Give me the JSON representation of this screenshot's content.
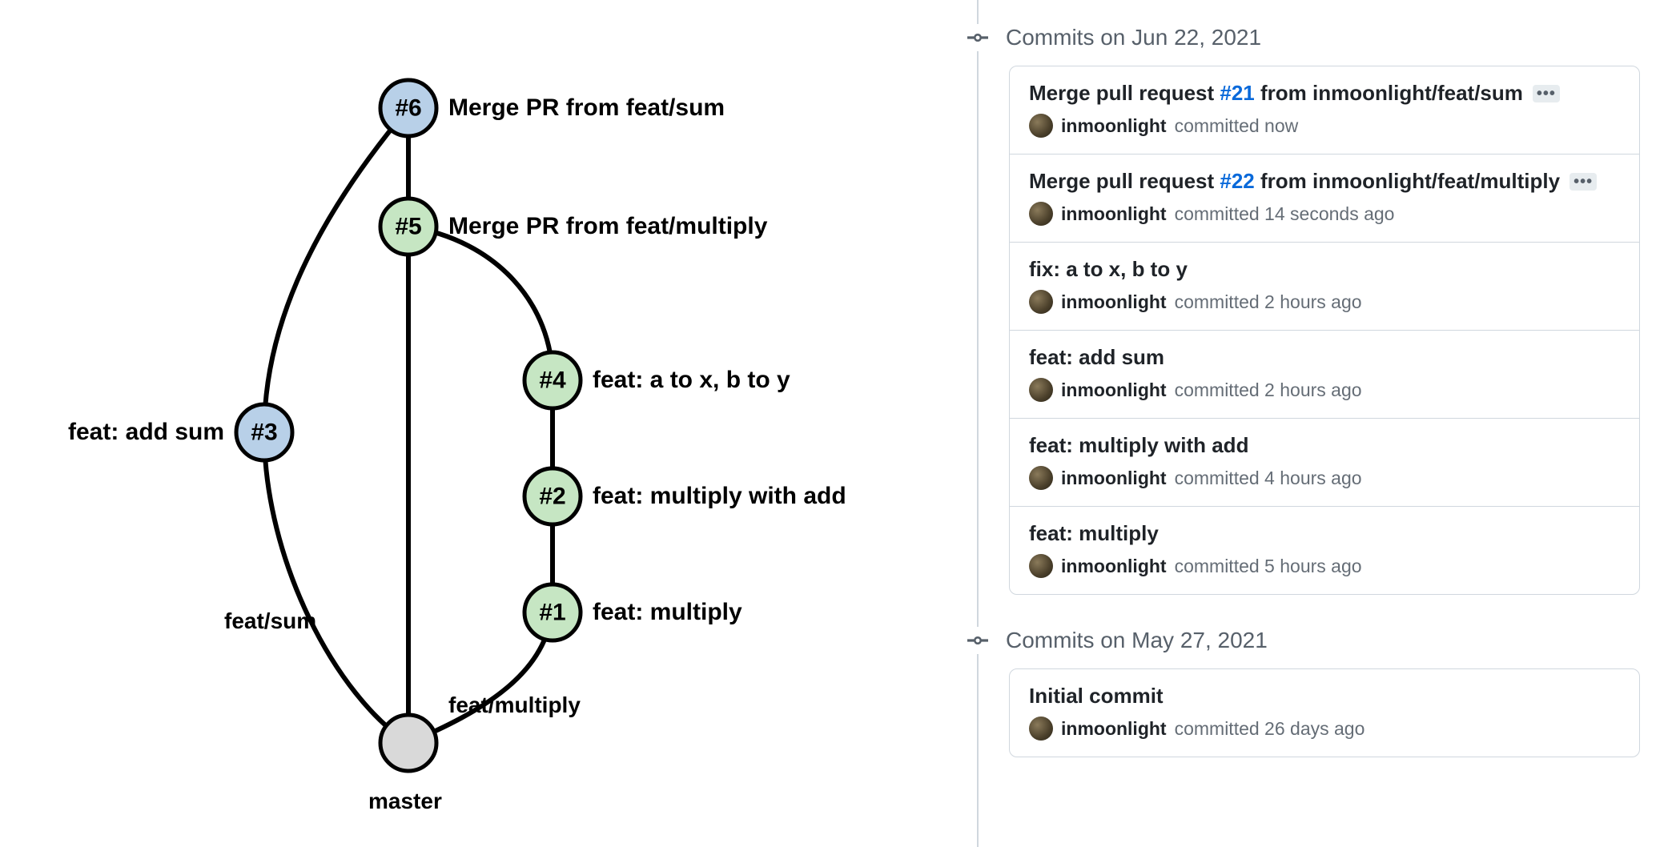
{
  "graph": {
    "nodes": {
      "n6": {
        "id": "#6",
        "label": "Merge PR from feat/sum"
      },
      "n5": {
        "id": "#5",
        "label": "Merge PR from feat/multiply"
      },
      "n4": {
        "id": "#4",
        "label": "feat: a to x, b to y"
      },
      "n3": {
        "id": "#3",
        "label": "feat: add sum"
      },
      "n2": {
        "id": "#2",
        "label": "feat: multiply with add"
      },
      "n1": {
        "id": "#1",
        "label": "feat: multiply"
      }
    },
    "branches": {
      "left": "feat/sum",
      "right": "feat/multiply",
      "base": "master"
    }
  },
  "commits": {
    "groups": [
      {
        "date": "Commits on Jun 22, 2021",
        "items": [
          {
            "title_pre": "Merge pull request ",
            "link": "#21",
            "title_post": " from inmoonlight/feat/sum",
            "author": "inmoonlight",
            "meta": "committed now",
            "ellipsis": true
          },
          {
            "title_pre": "Merge pull request ",
            "link": "#22",
            "title_post": " from inmoonlight/feat/multiply",
            "author": "inmoonlight",
            "meta": "committed 14 seconds ago",
            "ellipsis": true
          },
          {
            "title_pre": "fix: a to x, b to y",
            "link": "",
            "title_post": "",
            "author": "inmoonlight",
            "meta": "committed 2 hours ago",
            "ellipsis": false
          },
          {
            "title_pre": "feat: add sum",
            "link": "",
            "title_post": "",
            "author": "inmoonlight",
            "meta": "committed 2 hours ago",
            "ellipsis": false
          },
          {
            "title_pre": "feat: multiply with add",
            "link": "",
            "title_post": "",
            "author": "inmoonlight",
            "meta": "committed 4 hours ago",
            "ellipsis": false
          },
          {
            "title_pre": "feat: multiply",
            "link": "",
            "title_post": "",
            "author": "inmoonlight",
            "meta": "committed 5 hours ago",
            "ellipsis": false
          }
        ]
      },
      {
        "date": "Commits on May 27, 2021",
        "items": [
          {
            "title_pre": "Initial commit",
            "link": "",
            "title_post": "",
            "author": "inmoonlight",
            "meta": "committed 26 days ago",
            "ellipsis": false
          }
        ]
      }
    ]
  }
}
